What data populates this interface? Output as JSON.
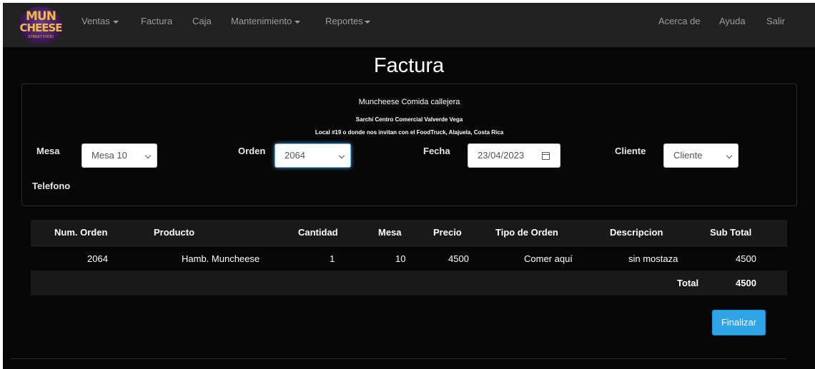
{
  "brand": {
    "line1": "MUN",
    "line2": "CHEESE",
    "line3": "STREET FOOD"
  },
  "nav": {
    "ventas": "Ventas",
    "factura": "Factura",
    "caja": "Caja",
    "mantenimiento": "Mantenimiento",
    "reportes": "Reportes",
    "acerca": "Acerca de",
    "ayuda": "Ayuda",
    "salir": "Salir"
  },
  "page": {
    "title": "Factura"
  },
  "business": {
    "name": "Muncheese Comida callejera",
    "address1": "Sarchí Centro Comercial Valverde Vega",
    "address2": "Local #19 o donde nos invitan con el FoodTruck, Alajuela, Costa Rica"
  },
  "form": {
    "mesa_label": "Mesa",
    "mesa_value": "Mesa 10",
    "orden_label": "Orden",
    "orden_value": "2064",
    "fecha_label": "Fecha",
    "fecha_value": "23/04/2023",
    "cliente_label": "Cliente",
    "cliente_value": "Cliente",
    "telefono_label": "Telefono"
  },
  "table": {
    "headers": [
      "Num. Orden",
      "Producto",
      "Cantidad",
      "Mesa",
      "Precio",
      "Tipo de Orden",
      "Descripcion",
      "Sub Total"
    ],
    "rows": [
      [
        "2064",
        "Hamb. Muncheese",
        "1",
        "10",
        "4500",
        "Comer aquí",
        "sin mostaza",
        "4500"
      ]
    ],
    "total_label": "Total",
    "total_value": "4500"
  },
  "actions": {
    "finalize": "Finalizar"
  }
}
